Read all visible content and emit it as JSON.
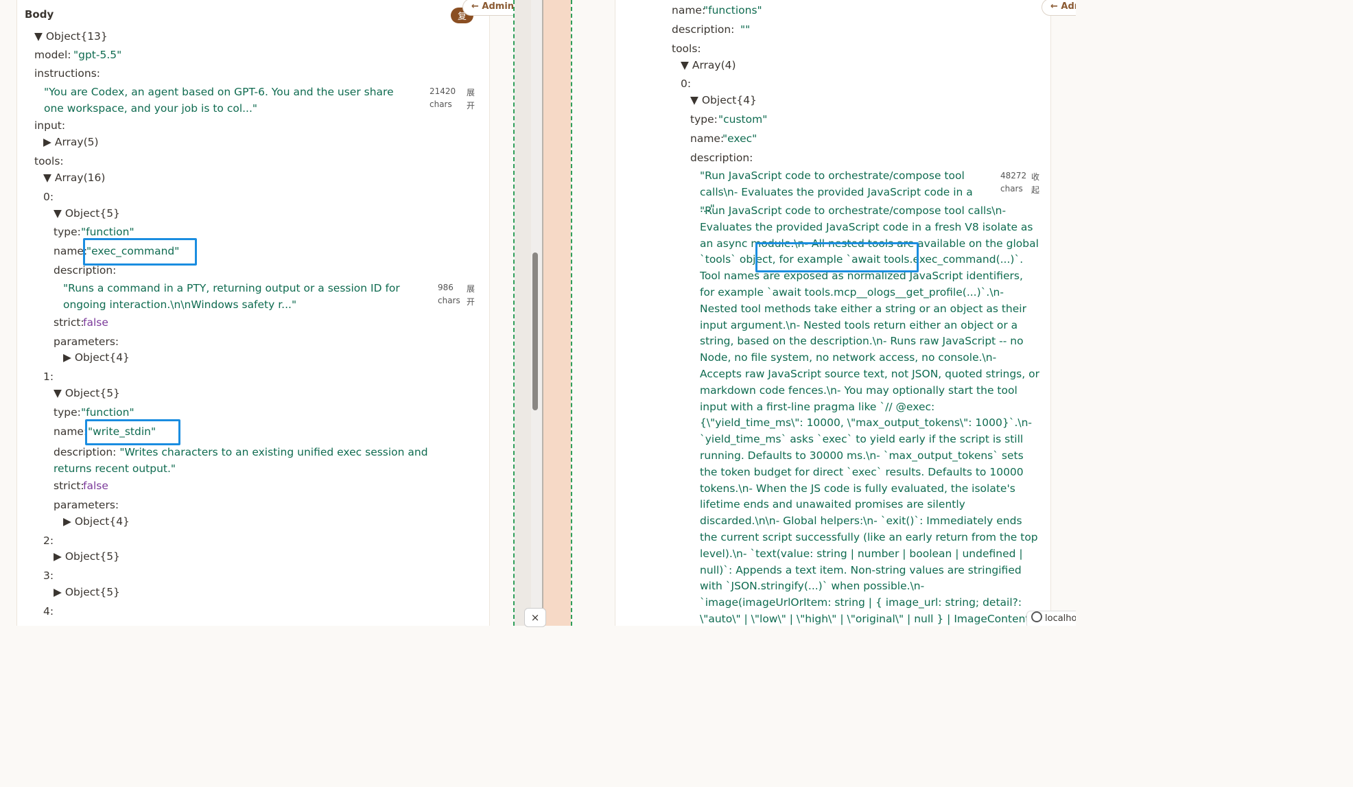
{
  "left": {
    "section_title": "Body",
    "badge_text": "复",
    "admin_button": "← Admin",
    "rows": [
      {
        "t": "▼ Object{13}"
      },
      {
        "t": "model: ",
        "v": "\"gpt-5.5\""
      },
      {
        "t": "instructions:"
      },
      {
        "t": "\"You are Codex, an agent based on GPT-6. You and the user share one workspace, and your job is to col...\""
      },
      {
        "t": "input:"
      },
      {
        "t": "▶ Array(5)"
      },
      {
        "t": "tools:"
      },
      {
        "t": "▼ Array(16)"
      }
    ],
    "model_key": "model:",
    "model_val": "\"gpt-5.5\"",
    "instructions_key": "instructions:",
    "instructions_val": "\"You are Codex, an agent based on GPT-6. You and the user share one workspace, and your job is to col...\"",
    "instructions_count": "21420",
    "instructions_count_unit": "chars",
    "expand_label": "展开",
    "object13": "▼ Object{13}",
    "input_key": "input:",
    "input_val": "▶ Array(5)",
    "tools_key": "tools:",
    "tools_val": "▼ Array(16)",
    "tool0_index": "0:",
    "tool0_obj": "▼ Object{5}",
    "tool0_type_key": "type:",
    "tool0_type_val": "\"function\"",
    "tool0_name_key": "name:",
    "tool0_name_val": "\"exec_command\"",
    "tool0_desc_key": "description:",
    "tool0_desc_val": "\"Runs a command in a PTY, returning output or a session ID for ongoing interaction.\\n\\nWindows safety r...\"",
    "tool0_desc_count": "986",
    "tool0_desc_unit": "chars",
    "tool0_strict_key": "strict:",
    "tool0_strict_val": "false",
    "tool0_params_key": "parameters:",
    "tool0_params_val": "▶ Object{4}",
    "tool1_index": "1:",
    "tool1_obj": "▼ Object{5}",
    "tool1_type_key": "type:",
    "tool1_type_val": "\"function\"",
    "tool1_name_key": "name:",
    "tool1_name_val": "\"write_stdin\"",
    "tool1_desc_key": "description:",
    "tool1_desc_val": "\"Writes characters to an existing unified exec session and returns recent output.\"",
    "tool1_strict_key": "strict:",
    "tool1_strict_val": "false",
    "tool1_params_key": "parameters:",
    "tool1_params_val": "▶ Object{4}",
    "tool2_index": "2:",
    "tool2_obj": "▶ Object{5}",
    "tool3_index": "3:",
    "tool3_obj": "▶ Object{5}",
    "tool4_index": "4:"
  },
  "right": {
    "admin_button": "← Adr",
    "name_key": "name:",
    "name_val": "\"functions\"",
    "desc_key": "description:",
    "desc_val": "\"\"",
    "tools_key": "tools:",
    "tools_val": "▼ Array(4)",
    "idx0": "0:",
    "obj4": "▼ Object{4}",
    "type_key": "type:",
    "type_val": "\"custom\"",
    "exec_name_key": "name:",
    "exec_name_val": "\"exec\"",
    "exec_desc_key": "description:",
    "exec_desc_preview": "\"Run JavaScript code to orchestrate/compose tool calls\\n- Evaluates the provided JavaScript code in a ...\"",
    "exec_desc_count": "48272",
    "exec_desc_unit": "chars",
    "collapse_label": "收起",
    "exec_desc_full": "\"Run JavaScript code to orchestrate/compose tool calls\\n- Evaluates the provided JavaScript code in a fresh V8 isolate as an async module.\\n- All nested tools are available on the global `tools` object, for example `await tools.exec_command(...)`. Tool names are exposed as normalized JavaScript identifiers, for example `await tools.mcp__ologs__get_profile(...)`.\\n- Nested tool methods take either a string or an object as their input argument.\\n- Nested tools return either an object or a string, based on the description.\\n- Runs raw JavaScript -- no Node, no file system, no network access, no console.\\n- Accepts raw JavaScript source text, not JSON, quoted strings, or markdown code fences.\\n- You may optionally start the tool input with a first-line pragma like `// @exec: {\\\"yield_time_ms\\\": 10000, \\\"max_output_tokens\\\": 1000}`.\\n- `yield_time_ms` asks `exec` to yield early if the script is still running. Defaults to 30000 ms.\\n- `max_output_tokens` sets the token budget for direct `exec` results. Defaults to 10000 tokens.\\n- When the JS code is fully evaluated, the isolate's lifetime ends and unawaited promises are silently discarded.\\n\\n- Global helpers:\\n- `exit()`: Immediately ends the current script successfully (like an early return from the top level).\\n- `text(value: string | number | boolean | undefined | null)`: Appends a text item. Non-string values are stringified with `JSON.stringify(...)` when possible.\\n- `image(imageUrlOrItem: string | { image_url: string; detail?: \\\"auto\\\" | \\\"low\\\" | \\\"high\\\" | \\\"original\\\" | null } | ImageContent, detail?: \\\"auto\\\" | \\\"low\\\" | \\\"high\\\" | \\\"original\\\" | null)`: Appends an image item. `image_url` should be a base64-encoded `data:` URL. To forward an MCP tool image, pass an individual `ImageContent` bloc",
    "localhost_label": "localhos"
  },
  "divider": {
    "close_label": "×"
  }
}
